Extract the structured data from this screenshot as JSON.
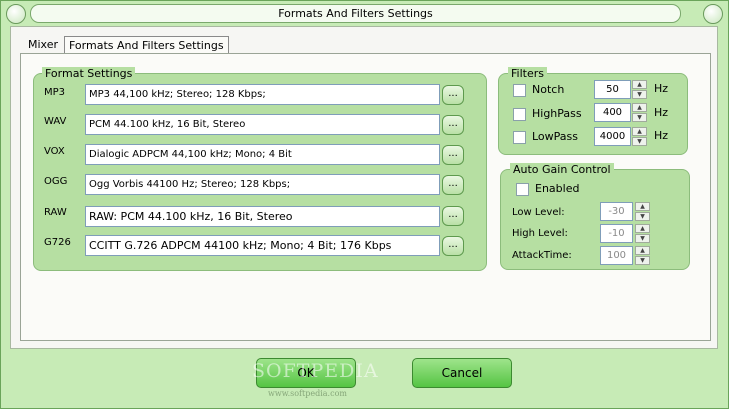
{
  "window": {
    "title": "Formats And Filters Settings"
  },
  "tabs": [
    {
      "label": "Mixer"
    },
    {
      "label": "Formats And Filters Settings"
    }
  ],
  "format_settings": {
    "title": "Format Settings",
    "browse_label": "...",
    "rows": [
      {
        "label": "MP3",
        "value": "MP3 44,100 kHz; Stereo;  128 Kbps;"
      },
      {
        "label": "WAV",
        "value": "PCM 44.100 kHz, 16 Bit, Stereo"
      },
      {
        "label": "VOX",
        "value": "Dialogic ADPCM 44,100 kHz; Mono; 4 Bit"
      },
      {
        "label": "OGG",
        "value": "Ogg Vorbis 44100 Hz; Stereo; 128 Kbps;"
      },
      {
        "label": "RAW",
        "value": "RAW: PCM 44.100 kHz, 16 Bit, Stereo"
      },
      {
        "label": "G726",
        "value": "CCITT G.726 ADPCM 44100 kHz; Mono; 4 Bit; 176 Kbps"
      }
    ]
  },
  "filters": {
    "title": "Filters",
    "unit": "Hz",
    "items": [
      {
        "label": "Notch",
        "value": "50",
        "checked": false
      },
      {
        "label": "HighPass",
        "value": "400",
        "checked": false
      },
      {
        "label": "LowPass",
        "value": "4000",
        "checked": false
      }
    ]
  },
  "agc": {
    "title": "Auto Gain Control",
    "enabled_label": "Enabled",
    "enabled": false,
    "low_level": {
      "label": "Low Level:",
      "value": "-30"
    },
    "high_level": {
      "label": "High Level:",
      "value": "-10"
    },
    "attack_time": {
      "label": "AttackTime:",
      "value": "100"
    }
  },
  "buttons": {
    "ok": "OK",
    "cancel": "Cancel"
  },
  "watermark": {
    "main": "SOFTPEDIA",
    "sub": "www.softpedia.com"
  },
  "colors": {
    "accent_green": "#55c443",
    "panel_green": "#b6dfa2",
    "frame_green": "#c7ebb6"
  }
}
